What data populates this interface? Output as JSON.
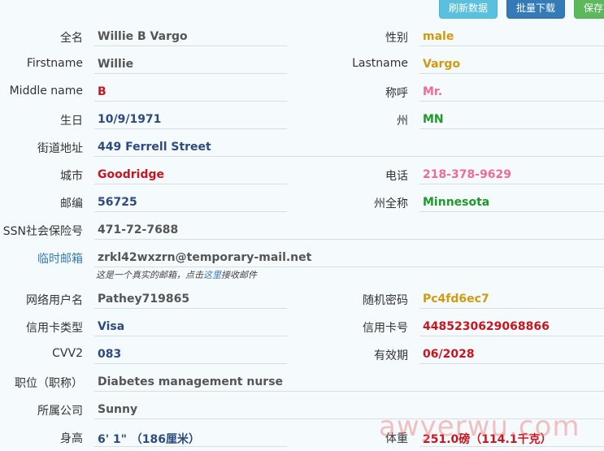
{
  "toolbar": {
    "refresh_label": "刷新数据",
    "download_label": "批量下载",
    "save_label": "保存"
  },
  "fields": {
    "fullname": {
      "label": "全名",
      "value": "Willie B Vargo"
    },
    "gender": {
      "label": "性别",
      "value": "male"
    },
    "firstname": {
      "label": "Firstname",
      "value": "Willie"
    },
    "lastname": {
      "label": "Lastname",
      "value": "Vargo"
    },
    "middlename": {
      "label": "Middle name",
      "value": "B"
    },
    "title": {
      "label": "称呼",
      "value": "Mr."
    },
    "birthday": {
      "label": "生日",
      "value": "10/9/1971"
    },
    "state": {
      "label": "州",
      "value": "MN"
    },
    "street": {
      "label": "街道地址",
      "value": "449 Ferrell Street"
    },
    "city": {
      "label": "城市",
      "value": "Goodridge"
    },
    "phone": {
      "label": "电话",
      "value": "218-378-9629"
    },
    "zip": {
      "label": "邮编",
      "value": "56725"
    },
    "state_full": {
      "label": "州全称",
      "value": "Minnesota"
    },
    "ssn": {
      "label": "SSN社会保险号",
      "value": "471-72-7688"
    },
    "temp_email": {
      "label": "临时邮箱",
      "value": "zrkl42wxzrn@temporary-mail.net"
    },
    "email_hint": {
      "prefix": "这是一个真实的邮箱，点击",
      "link": "这里",
      "suffix": "接收邮件"
    },
    "username": {
      "label": "网络用户名",
      "value": "Pathey719865"
    },
    "password": {
      "label": "随机密码",
      "value": "Pc4fd6ec7"
    },
    "card_type": {
      "label": "信用卡类型",
      "value": "Visa"
    },
    "card_number": {
      "label": "信用卡号",
      "value": "4485230629068866"
    },
    "cvv": {
      "label": "CVV2",
      "value": "083"
    },
    "expiry": {
      "label": "有效期",
      "value": "06/2028"
    },
    "occupation": {
      "label": "职位（职称）",
      "value": "Diabetes management nurse"
    },
    "company": {
      "label": "所属公司",
      "value": "Sunny"
    },
    "height": {
      "label": "身高",
      "value": "6' 1\" （186厘米）"
    },
    "weight": {
      "label": "体重",
      "value": "251.0磅（114.1千克）"
    }
  },
  "watermark": "awyerwu.com"
}
